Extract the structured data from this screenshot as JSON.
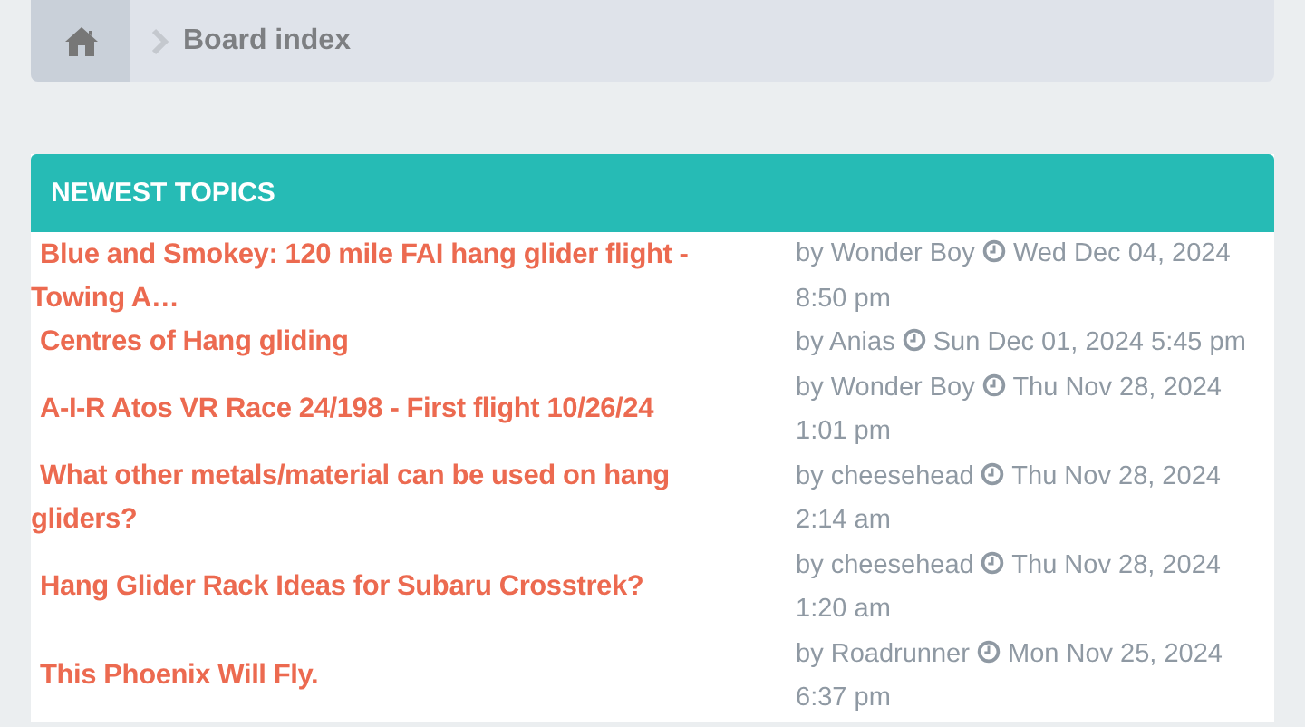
{
  "breadcrumb": {
    "items": [
      {
        "label": "Board index"
      }
    ]
  },
  "panel": {
    "title": "NEWEST TOPICS",
    "topics": [
      {
        "title": "Blue and Smokey: 120 mile FAI hang glider flight - Towing A…",
        "byline": "by Wonder Boy",
        "date": "Wed Dec 04, 2024",
        "time": "8:50 pm"
      },
      {
        "title": "Centres of Hang gliding",
        "byline": "by Anias",
        "date": "Sun Dec 01, 2024",
        "time": "5:45 pm"
      },
      {
        "title": "A-I-R Atos VR Race 24/198 - First flight 10/26/24",
        "byline": "by Wonder Boy",
        "date": "Thu Nov 28, 2024",
        "time": "1:01 pm"
      },
      {
        "title": "What other metals/material can be used on hang gliders?",
        "byline": "by cheesehead",
        "date": "Thu Nov 28, 2024",
        "time": "2:14 am"
      },
      {
        "title": "Hang Glider Rack Ideas for Subaru Crosstrek?",
        "byline": "by cheesehead",
        "date": "Thu Nov 28, 2024",
        "time": "1:20 am"
      },
      {
        "title": "This Phoenix Will Fly.",
        "byline": "by Roadrunner",
        "date": "Mon Nov 25, 2024",
        "time": "6:37 pm"
      }
    ]
  }
}
